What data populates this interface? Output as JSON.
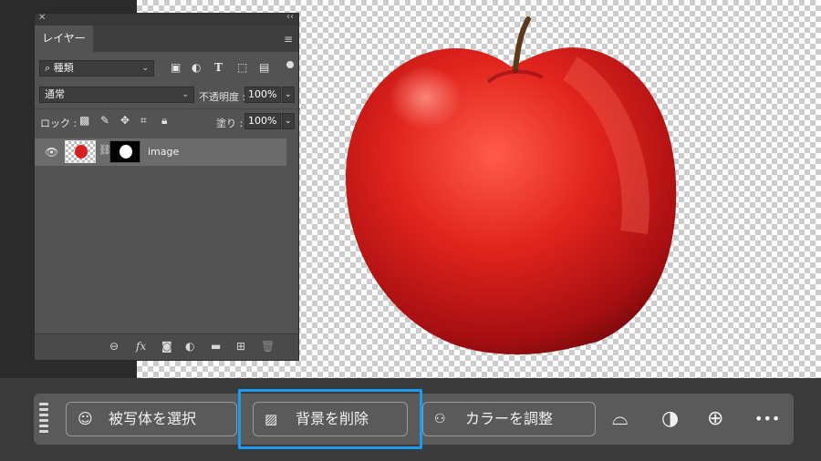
{
  "layers_panel": {
    "close_glyph": "✕",
    "collapse_glyph": "‹‹",
    "tab_label": "レイヤー",
    "menu_glyph": "≡",
    "filter": {
      "value": "種類",
      "icon": "search-icon"
    },
    "blend_mode": "通常",
    "opacity_label": "不透明度 :",
    "opacity_value": "100%",
    "lock_label": "ロック :",
    "fill_label": "塗り :",
    "fill_value": "100%",
    "layer": {
      "name": "image",
      "visible": true
    }
  },
  "taskbar": {
    "select_subject_label": "被写体を選択",
    "remove_background_label": "背景を削除",
    "adjust_color_label": "カラーを調整",
    "more_glyph": "•••",
    "highlight_color": "#1a9af0"
  },
  "colors": {
    "apple_red": "#d52121",
    "panel_bg": "#535353",
    "taskbar_bg": "#5a5a5a"
  }
}
